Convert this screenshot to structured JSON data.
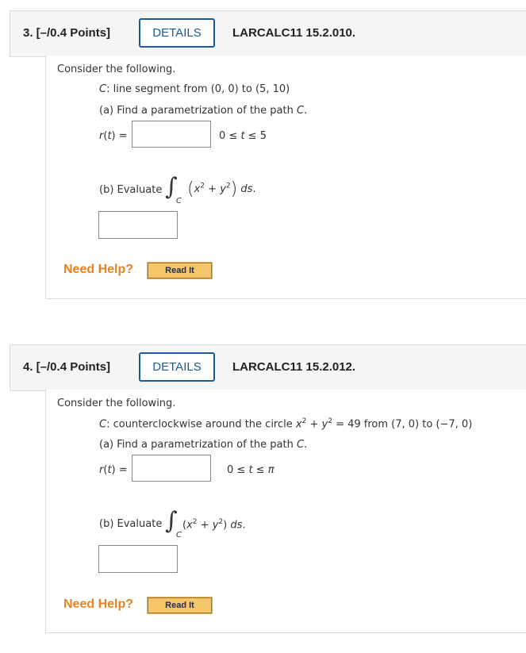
{
  "questions": [
    {
      "title": "3. [–/0.4 Points]",
      "details_label": "DETAILS",
      "code": "LARCALC11 15.2.010.",
      "intro": "Consider the following.",
      "curve_prefix": "C: line segment from (0, 0) to (5, 10)",
      "part_a": "(a) Find a parametrization of the path C.",
      "r_label": "r(t) =",
      "r_value": "",
      "range": "0 ≤ t ≤ 5",
      "part_b": "(b) Evaluate",
      "integral_sub": "C",
      "integrand_x": "x",
      "integrand_y": "y",
      "exp": "2",
      "plus": "+",
      "ds": "ds.",
      "b_value": "",
      "need_help": "Need Help?",
      "read_it": "Read It"
    },
    {
      "title": "4. [–/0.4 Points]",
      "details_label": "DETAILS",
      "code": "LARCALC11 15.2.012.",
      "intro": "Consider the following.",
      "curve_prefix": "C: counterclockwise around the circle x",
      "curve_mid": " + y",
      "curve_suffix": " = 49 from (7, 0) to (−7, 0)",
      "part_a": "(a) Find a parametrization of the path C.",
      "r_label": "r(t) =",
      "r_value": "",
      "range": "0 ≤ t ≤ π",
      "part_b": "(b) Evaluate",
      "integral_sub": "C",
      "integrand": "(x",
      "integrand_mid": " + y",
      "integrand_end": ") ds.",
      "exp": "2",
      "b_value": "",
      "need_help": "Need Help?",
      "read_it": "Read It"
    }
  ],
  "colors": {
    "accent": "#1c5a96",
    "help": "#e8821e",
    "read_it_bg": "#f6c66b",
    "header_bg": "#f5f5f5"
  }
}
